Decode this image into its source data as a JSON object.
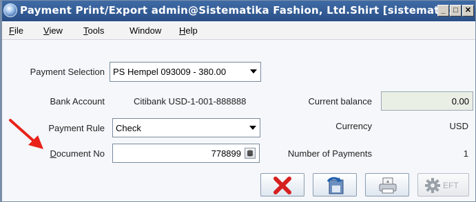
{
  "window": {
    "title": "Payment Print/Export  admin@Sistematika Fashion, Ltd.Shirt [sistematik...",
    "controls": {
      "minimize": "_",
      "maximize": "□",
      "close": "✕"
    }
  },
  "menu": {
    "items": [
      {
        "label": "File",
        "mnemonic": "F",
        "rest": "ile"
      },
      {
        "label": "View",
        "mnemonic": "V",
        "rest": "iew"
      },
      {
        "label": "Tools",
        "mnemonic": "T",
        "rest": "ools"
      },
      {
        "label": "Window",
        "mnemonic": "",
        "rest": "Window"
      },
      {
        "label": "Help",
        "mnemonic": "H",
        "rest": "elp"
      }
    ]
  },
  "form": {
    "payment_selection": {
      "label": "Payment Selection",
      "value": "PS Hempel 093009 - 380.00"
    },
    "bank_account": {
      "label": "Bank Account",
      "value": "Citibank USD-1-001-888888"
    },
    "current_balance": {
      "label": "Current balance",
      "value": "0.00"
    },
    "payment_rule": {
      "label": "Payment Rule",
      "value": "Check"
    },
    "currency": {
      "label": "Currency",
      "value": "USD"
    },
    "document_no": {
      "label_mnemonic": "D",
      "label_rest": "ocument No",
      "label": "Document No",
      "value": "778899"
    },
    "number_of_payments": {
      "label": "Number of Payments",
      "value": "1"
    }
  },
  "buttons": {
    "eft_label": "EFT"
  },
  "colors": {
    "title_bar": "#2f5a94",
    "annotation_arrow": "#e8221a",
    "cancel_x": "#d62020"
  }
}
